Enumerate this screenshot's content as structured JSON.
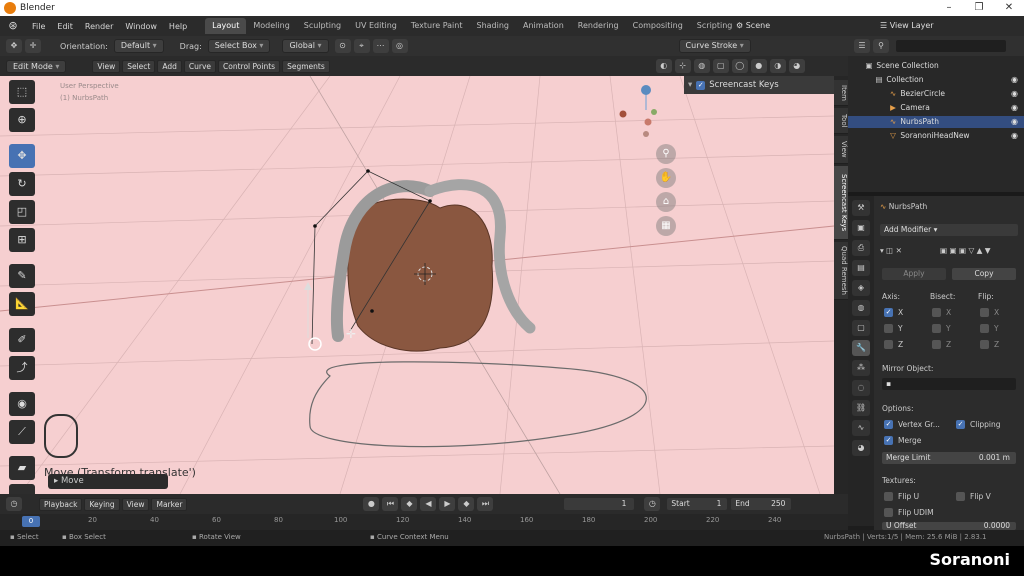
{
  "app": {
    "title": "Blender",
    "window_controls": [
      "–",
      "❐",
      "✕"
    ]
  },
  "menu": {
    "items": [
      "File",
      "Edit",
      "Render",
      "Window",
      "Help"
    ]
  },
  "workspaces": {
    "tabs": [
      "Layout",
      "Modeling",
      "Sculpting",
      "UV Editing",
      "Texture Paint",
      "Shading",
      "Animation",
      "Rendering",
      "Compositing",
      "Scripting"
    ],
    "active": "Layout"
  },
  "scene": {
    "name": "Scene",
    "view_layer": "View Layer"
  },
  "tool_header": {
    "orientation_label": "Orientation:",
    "orientation_value": "Default",
    "drag_label": "Drag:",
    "drag_value": "Select Box",
    "transform_value": "Global",
    "curve_stroke": "Curve Stroke"
  },
  "viewport_header": {
    "mode": "Edit Mode",
    "menus": [
      "View",
      "Select",
      "Add",
      "Curve",
      "Control Points",
      "Segments"
    ]
  },
  "viewport": {
    "background_color": "#f6cfd0",
    "info_line1": "User Perspective",
    "info_line2": "(1) NurbsPath",
    "screencast_keys_label": "Screencast Keys",
    "move_operator_label": "Move (Transform.translate')",
    "move_panel_label": "Move",
    "sidetabs": [
      "Item",
      "Tool",
      "View",
      "Screencast Keys",
      "Quad Remesh"
    ]
  },
  "outliner": {
    "scene_collection": "Scene Collection",
    "items": [
      {
        "name": "Collection",
        "icon": "collection-icon",
        "selected": false
      },
      {
        "name": "BezierCircle",
        "icon": "curve-icon",
        "selected": false
      },
      {
        "name": "Camera",
        "icon": "camera-icon",
        "selected": false
      },
      {
        "name": "NurbsPath",
        "icon": "curve-icon",
        "selected": true
      },
      {
        "name": "SoranoniHeadNew",
        "icon": "mesh-icon",
        "selected": false
      }
    ]
  },
  "properties": {
    "object_name": "NurbsPath",
    "add_modifier": "Add Modifier",
    "apply": "Apply",
    "copy": "Copy",
    "axis_label": "Axis:",
    "bisect_label": "Bisect:",
    "flip_label": "Flip:",
    "axis_x": "X",
    "axis_y": "Y",
    "axis_z": "Z",
    "mirror_object_label": "Mirror Object:",
    "options_label": "Options:",
    "vertex_groups": "Vertex Gr...",
    "clipping": "Clipping",
    "merge": "Merge",
    "merge_limit_label": "Merge Limit",
    "merge_limit_value": "0.001 m",
    "textures_label": "Textures:",
    "flip_u": "Flip U",
    "flip_v": "Flip V",
    "flip_udim": "Flip UDIM",
    "u_offset_label": "U Offset",
    "u_offset_value": "0.0000"
  },
  "timeline": {
    "menus": [
      "Playback",
      "Keying",
      "View",
      "Marker"
    ],
    "current_frame": "1",
    "start_label": "Start",
    "start_value": "1",
    "end_label": "End",
    "end_value": "250",
    "ticks": [
      "0",
      "20",
      "40",
      "60",
      "80",
      "100",
      "120",
      "140",
      "160",
      "180",
      "200",
      "220",
      "240"
    ]
  },
  "statusbar": {
    "select": "Select",
    "box_select": "Box Select",
    "rotate_view": "Rotate View",
    "context_menu": "Curve Context Menu",
    "stats": "NurbsPath | Verts:1/5 | Mem: 25.6 MiB | 2.83.1"
  },
  "branding": {
    "text": "Soranoni"
  }
}
